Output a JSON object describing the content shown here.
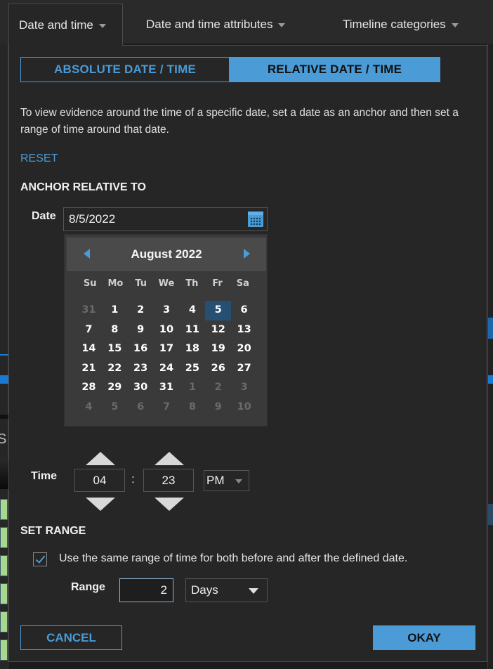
{
  "tabs": [
    {
      "label": "Date and time",
      "active": true
    },
    {
      "label": "Date and time attributes",
      "active": false
    },
    {
      "label": "Timeline categories",
      "active": false
    }
  ],
  "mode_toggle": {
    "absolute_label": "ABSOLUTE DATE / TIME",
    "relative_label": "RELATIVE DATE / TIME",
    "selected": "relative"
  },
  "description": "To view evidence around the time of a specific date, set a date as an anchor and then set a range of time around that date.",
  "reset_label": "RESET",
  "anchor": {
    "heading": "ANCHOR RELATIVE TO",
    "date_label": "Date",
    "date_value": "8/5/2022",
    "calendar_icon": "calendar-icon"
  },
  "calendar": {
    "title": "August 2022",
    "prev_icon": "triangle-left-icon",
    "next_icon": "triangle-right-icon",
    "weekdays": [
      "Su",
      "Mo",
      "Tu",
      "We",
      "Th",
      "Fr",
      "Sa"
    ],
    "selected_day": "5",
    "weeks": [
      [
        {
          "d": "31",
          "m": true
        },
        {
          "d": "1"
        },
        {
          "d": "2"
        },
        {
          "d": "3"
        },
        {
          "d": "4"
        },
        {
          "d": "5",
          "sel": true
        },
        {
          "d": "6"
        }
      ],
      [
        {
          "d": "7"
        },
        {
          "d": "8"
        },
        {
          "d": "9"
        },
        {
          "d": "10"
        },
        {
          "d": "11"
        },
        {
          "d": "12"
        },
        {
          "d": "13"
        }
      ],
      [
        {
          "d": "14"
        },
        {
          "d": "15"
        },
        {
          "d": "16"
        },
        {
          "d": "17"
        },
        {
          "d": "18"
        },
        {
          "d": "19"
        },
        {
          "d": "20"
        }
      ],
      [
        {
          "d": "21"
        },
        {
          "d": "22"
        },
        {
          "d": "23"
        },
        {
          "d": "24"
        },
        {
          "d": "25"
        },
        {
          "d": "26"
        },
        {
          "d": "27"
        }
      ],
      [
        {
          "d": "28"
        },
        {
          "d": "29"
        },
        {
          "d": "30"
        },
        {
          "d": "31"
        },
        {
          "d": "1",
          "m": true
        },
        {
          "d": "2",
          "m": true
        },
        {
          "d": "3",
          "m": true
        }
      ],
      [
        {
          "d": "4",
          "m": true
        },
        {
          "d": "5",
          "m": true
        },
        {
          "d": "6",
          "m": true
        },
        {
          "d": "7",
          "m": true
        },
        {
          "d": "8",
          "m": true
        },
        {
          "d": "9",
          "m": true
        },
        {
          "d": "10",
          "m": true
        }
      ]
    ]
  },
  "time": {
    "label": "Time",
    "hour": "04",
    "separator": ":",
    "minute": "23",
    "ampm": "PM"
  },
  "range": {
    "heading": "SET RANGE",
    "same_range_checked": true,
    "same_range_label": "Use the same range of time for both before and after the defined date.",
    "label": "Range",
    "value": "2",
    "unit": "Days"
  },
  "buttons": {
    "cancel": "CANCEL",
    "okay": "OKAY"
  },
  "colors": {
    "accent": "#4a9bd6",
    "selected_day_bg": "#264f72",
    "panel_bg": "#262626"
  }
}
